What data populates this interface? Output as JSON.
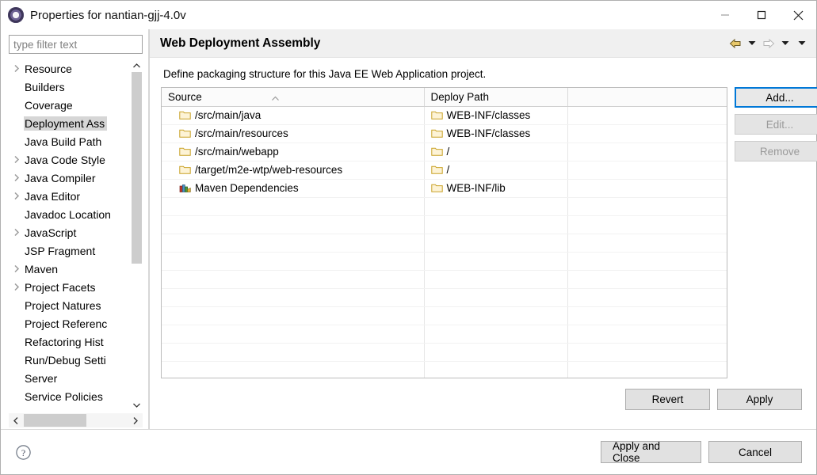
{
  "window": {
    "title": "Properties for nantian-gjj-4.0v",
    "icon": "eclipse-icon",
    "controls": {
      "minimize": "minimize-icon",
      "maximize": "maximize-icon",
      "close": "close-icon"
    }
  },
  "sidebar": {
    "filter": {
      "value": "",
      "placeholder": "type filter text"
    },
    "items": [
      {
        "label": "Resource",
        "expandable": true,
        "selected": false
      },
      {
        "label": "Builders",
        "expandable": false,
        "selected": false
      },
      {
        "label": "Coverage",
        "expandable": false,
        "selected": false
      },
      {
        "label": "Deployment Ass",
        "expandable": false,
        "selected": true
      },
      {
        "label": "Java Build Path",
        "expandable": false,
        "selected": false
      },
      {
        "label": "Java Code Style",
        "expandable": true,
        "selected": false
      },
      {
        "label": "Java Compiler",
        "expandable": true,
        "selected": false
      },
      {
        "label": "Java Editor",
        "expandable": true,
        "selected": false
      },
      {
        "label": "Javadoc Location",
        "expandable": false,
        "selected": false
      },
      {
        "label": "JavaScript",
        "expandable": true,
        "selected": false
      },
      {
        "label": "JSP Fragment",
        "expandable": false,
        "selected": false
      },
      {
        "label": "Maven",
        "expandable": true,
        "selected": false
      },
      {
        "label": "Project Facets",
        "expandable": true,
        "selected": false
      },
      {
        "label": "Project Natures",
        "expandable": false,
        "selected": false
      },
      {
        "label": "Project Referenc",
        "expandable": false,
        "selected": false
      },
      {
        "label": "Refactoring Hist",
        "expandable": false,
        "selected": false
      },
      {
        "label": "Run/Debug Setti",
        "expandable": false,
        "selected": false
      },
      {
        "label": "Server",
        "expandable": false,
        "selected": false
      },
      {
        "label": "Service Policies",
        "expandable": false,
        "selected": false
      }
    ],
    "scroll_up_icon": "chevron-up-icon",
    "scroll_down_icon": "chevron-down-icon",
    "scroll_left_icon": "chevron-left-icon",
    "scroll_right_icon": "chevron-right-icon"
  },
  "page": {
    "title": "Web Deployment Assembly",
    "description": "Define packaging structure for this Java EE Web Application project.",
    "nav": [
      {
        "name": "back-icon",
        "enabled": true
      },
      {
        "name": "back-dropdown-icon",
        "enabled": true
      },
      {
        "name": "forward-icon",
        "enabled": false
      },
      {
        "name": "forward-dropdown-icon",
        "enabled": true
      },
      {
        "name": "view-menu-icon",
        "enabled": true
      }
    ]
  },
  "table": {
    "columns": [
      "Source",
      "Deploy Path",
      ""
    ],
    "sort_column": "Source",
    "sort_direction": "ascending",
    "rows": [
      {
        "source": "/src/main/java",
        "source_icon": "folder-icon",
        "deploy": "WEB-INF/classes",
        "deploy_icon": "folder-icon"
      },
      {
        "source": "/src/main/resources",
        "source_icon": "folder-icon",
        "deploy": "WEB-INF/classes",
        "deploy_icon": "folder-icon"
      },
      {
        "source": "/src/main/webapp",
        "source_icon": "folder-icon",
        "deploy": "/",
        "deploy_icon": "folder-icon"
      },
      {
        "source": "/target/m2e-wtp/web-resources",
        "source_icon": "folder-icon",
        "deploy": "/",
        "deploy_icon": "folder-icon"
      },
      {
        "source": "Maven Dependencies",
        "source_icon": "library-icon",
        "deploy": "WEB-INF/lib",
        "deploy_icon": "folder-icon"
      }
    ],
    "empty_row_count": 13
  },
  "side_buttons": [
    {
      "label": "Add...",
      "state": "focused"
    },
    {
      "label": "Edit...",
      "state": "disabled"
    },
    {
      "label": "Remove",
      "state": "disabled"
    }
  ],
  "apply_buttons": [
    {
      "label": "Revert",
      "state": "enabled"
    },
    {
      "label": "Apply",
      "state": "enabled"
    }
  ],
  "footer": {
    "help_icon": "help-icon",
    "buttons": [
      {
        "label": "Apply and Close",
        "state": "enabled"
      },
      {
        "label": "Cancel",
        "state": "enabled"
      }
    ]
  },
  "colors": {
    "accent": "#0078d7",
    "folder": "#f5deaa",
    "folder_outline": "#c9a227",
    "header_bg": "#f0f0f0",
    "selection": "#d6d6d6",
    "button_bg": "#e1e1e1",
    "back_arrow": "#e8c86a"
  }
}
